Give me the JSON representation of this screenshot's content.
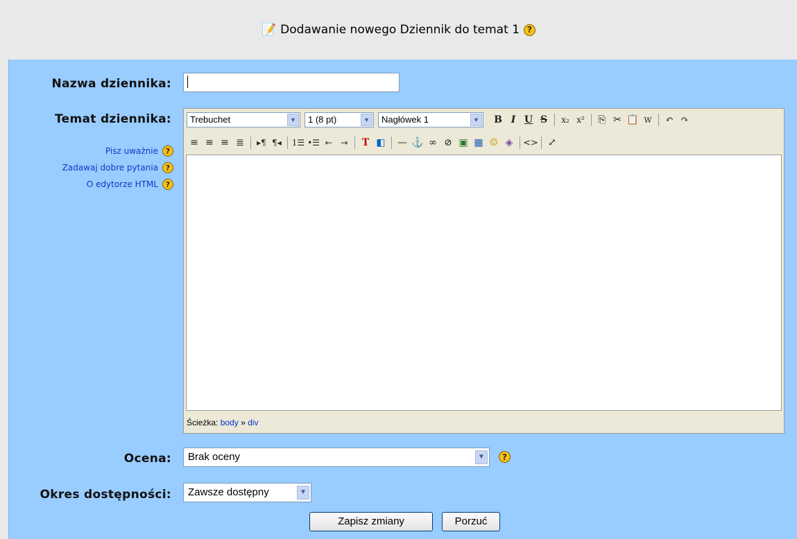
{
  "header": {
    "title": "Dodawanie nowego Dziennik do temat 1"
  },
  "form": {
    "name_label": "Nazwa dziennika",
    "name_value": "",
    "topic_label": "Temat dziennika",
    "help_links": [
      "Pisz uważnie",
      "Zadawaj dobre pytania",
      "O edytorze HTML"
    ],
    "grade_label": "Ocena",
    "grade_value": "Brak oceny",
    "availability_label": "Okres dostępności",
    "availability_value": "Zawsze dostępny",
    "save_label": "Zapisz zmiany",
    "cancel_label": "Porzuć"
  },
  "editor": {
    "font_value": "Trebuchet",
    "size_value": "1 (8 pt)",
    "heading_value": "Nagłówek 1",
    "path_label": "Ścieżka:",
    "path_body": "body",
    "path_sep": "»",
    "path_div": "div"
  }
}
